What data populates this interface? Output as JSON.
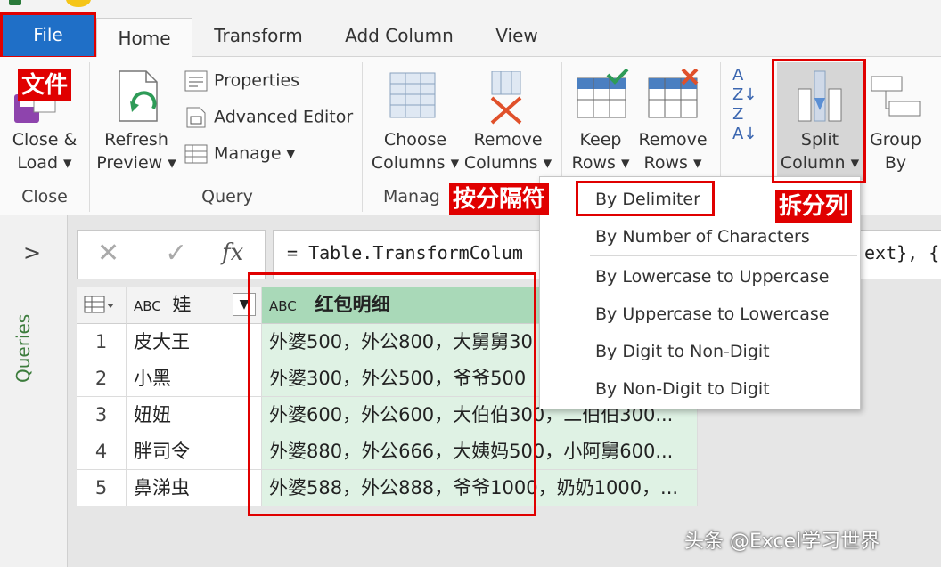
{
  "tabs": {
    "file": "File",
    "home": "Home",
    "transform": "Transform",
    "add_column": "Add Column",
    "view": "View"
  },
  "ribbon": {
    "close_load": [
      "Close &",
      "Load ▾"
    ],
    "refresh_preview": [
      "Refresh",
      "Preview ▾"
    ],
    "properties": "Properties",
    "advanced_editor": "Advanced Editor",
    "manage": "Manage ▾",
    "choose_columns": [
      "Choose",
      "Columns ▾"
    ],
    "remove_columns": [
      "Remove",
      "Columns ▾"
    ],
    "keep_rows": [
      "Keep",
      "Rows ▾"
    ],
    "remove_rows": [
      "Remove",
      "Rows ▾"
    ],
    "split_column": [
      "Split",
      "Column ▾"
    ],
    "group_by": [
      "Group",
      "By"
    ],
    "groups": {
      "close": "Close",
      "query": "Query",
      "manage": "Manag"
    }
  },
  "annotations": {
    "file_cn": "文件",
    "by_delimiter_cn": "按分隔符",
    "split_column_cn": "拆分列"
  },
  "queries_pane": {
    "label": "Queries",
    "expand": ">"
  },
  "formula": {
    "text": "= Table.TransformColum",
    "tail": "ext}, {",
    "fx": "fx"
  },
  "grid": {
    "columns": [
      {
        "type": "ABC",
        "name": "娃"
      },
      {
        "type": "ABC",
        "name": "红包明细"
      }
    ],
    "rows": [
      {
        "num": "1",
        "name": "皮大王",
        "detail": "外婆500，外公800，大舅舅30"
      },
      {
        "num": "2",
        "name": "小黑",
        "detail": "外婆300，外公500，爷爷500"
      },
      {
        "num": "3",
        "name": "妞妞",
        "detail": "外婆600，外公600，大伯伯300，二伯伯300..."
      },
      {
        "num": "4",
        "name": "胖司令",
        "detail": "外婆880，外公666，大姨妈500，小阿舅600..."
      },
      {
        "num": "5",
        "name": "鼻涕虫",
        "detail": "外婆588，外公888，爷爷1000，奶奶1000，..."
      }
    ]
  },
  "split_menu": {
    "items": [
      "By Delimiter",
      "By Number of Characters",
      "By Lowercase to Uppercase",
      "By Uppercase to Lowercase",
      "By Digit to Non-Digit",
      "By Non-Digit to Digit"
    ]
  },
  "watermark": "头条 @Excel学习世界",
  "colors": {
    "file_tab": "#1f6fc7",
    "annotation_red": "#e00000",
    "column_header_green": "#a9d9b8",
    "data_cell_green": "#dff2e4"
  }
}
